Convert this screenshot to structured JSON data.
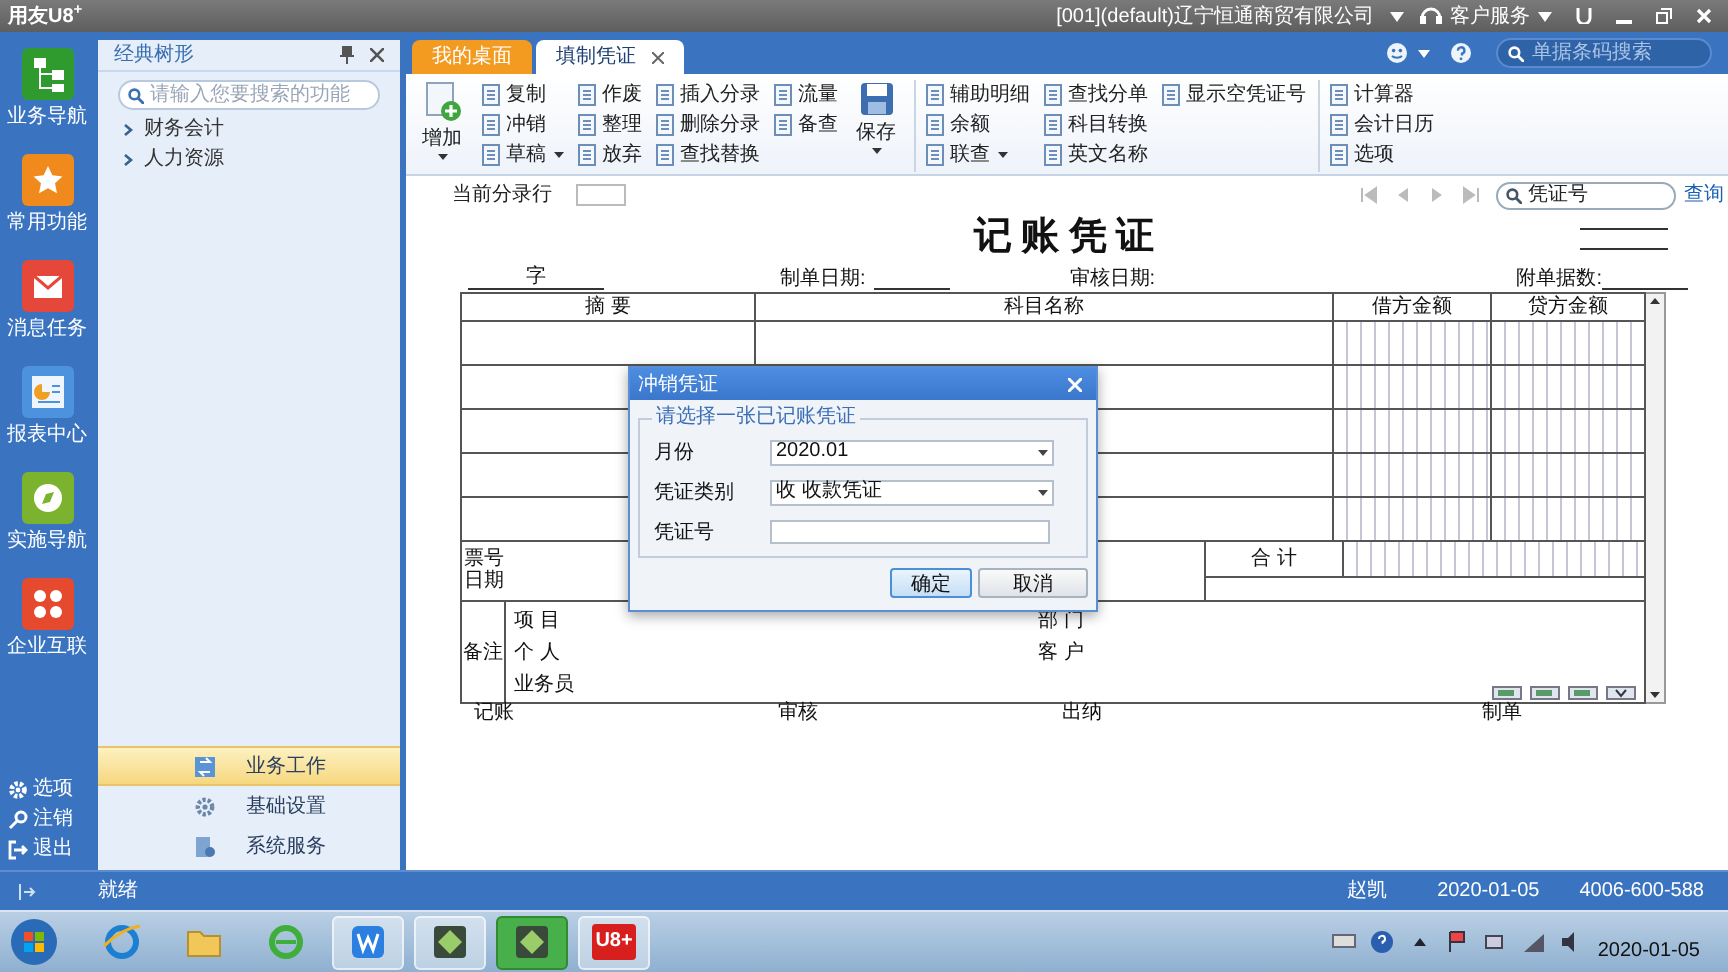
{
  "title_bar": {
    "app_name": "用友U8$^{+}$",
    "company": "[001](default)辽宁恒通商贸有限公司",
    "service": "客户服务"
  },
  "tabs": [
    {
      "label": "我的桌面",
      "selected": false,
      "closable": false
    },
    {
      "label": "填制凭证",
      "selected": true,
      "closable": true
    }
  ],
  "search": {
    "placeholder": "单据条码搜索"
  },
  "nav_rail": {
    "items": [
      {
        "label": "业务导航"
      },
      {
        "label": "常用功能"
      },
      {
        "label": "消息任务"
      },
      {
        "label": "报表中心"
      },
      {
        "label": "实施导航"
      },
      {
        "label": "企业互联"
      }
    ],
    "footer": [
      {
        "label": "选项"
      },
      {
        "label": "注销"
      },
      {
        "label": "退出"
      }
    ]
  },
  "tree_panel": {
    "title": "经典树形",
    "search_placeholder": "请输入您要搜索的功能",
    "items": [
      {
        "label": "财务会计",
        "expanded": false
      },
      {
        "label": "人力资源",
        "expanded": false
      }
    ],
    "sections": [
      {
        "label": "业务工作",
        "selected": true
      },
      {
        "label": "基础设置",
        "selected": false
      },
      {
        "label": "系统服务",
        "selected": false
      }
    ]
  },
  "toolbar": {
    "groups": [
      {
        "columns": [
          {
            "kind": "large",
            "items": [
              {
                "label": "增加",
                "dropdown": true
              }
            ]
          },
          {
            "kind": "small",
            "items": [
              {
                "label": "复制",
                "dropdown": false
              },
              {
                "label": "冲销",
                "dropdown": false
              },
              {
                "label": "草稿",
                "dropdown": true
              }
            ]
          },
          {
            "kind": "small",
            "items": [
              {
                "label": "作废",
                "dropdown": false
              },
              {
                "label": "整理",
                "dropdown": false
              },
              {
                "label": "放弃",
                "dropdown": false
              }
            ]
          },
          {
            "kind": "small",
            "items": [
              {
                "label": "插入分录",
                "dropdown": false
              },
              {
                "label": "删除分录",
                "dropdown": false
              },
              {
                "label": "查找替换",
                "dropdown": false
              }
            ]
          },
          {
            "kind": "small",
            "items": [
              {
                "label": "流量",
                "dropdown": false
              },
              {
                "label": "备查",
                "dropdown": false
              }
            ]
          },
          {
            "kind": "large",
            "items": [
              {
                "label": "保存",
                "dropdown": true
              }
            ]
          }
        ]
      },
      {
        "columns": [
          {
            "kind": "small",
            "items": [
              {
                "label": "辅助明细",
                "dropdown": false
              },
              {
                "label": "余额",
                "dropdown": false
              },
              {
                "label": "联查",
                "dropdown": true
              }
            ]
          },
          {
            "kind": "small",
            "items": [
              {
                "label": "查找分单",
                "dropdown": false
              },
              {
                "label": "科目转换",
                "dropdown": false
              },
              {
                "label": "英文名称",
                "dropdown": false
              }
            ]
          },
          {
            "kind": "small",
            "items": [
              {
                "label": "显示空凭证号",
                "dropdown": false
              }
            ]
          }
        ]
      },
      {
        "columns": [
          {
            "kind": "small",
            "items": [
              {
                "label": "计算器",
                "dropdown": false
              },
              {
                "label": "会计日历",
                "dropdown": false
              },
              {
                "label": "选项",
                "dropdown": false
              }
            ]
          }
        ]
      }
    ]
  },
  "voucher": {
    "current_row_label": "当前分录行",
    "search_label": "凭证号",
    "query_link": "查询",
    "title": "记 账 凭 证",
    "header_fields": [
      "字",
      "制单日期:",
      "审核日期:",
      "附单据数:"
    ],
    "columns": [
      "摘 要",
      "科目名称",
      "借方金额",
      "贷方金额"
    ],
    "ticket_labels": [
      "票号",
      "日期"
    ],
    "total_label": "合 计",
    "remarks_label": "备注",
    "remarks_left": [
      "项 目",
      "个 人",
      "业务员"
    ],
    "remarks_right": [
      "部 门",
      "客 户"
    ],
    "signatures": [
      "记账",
      "审核",
      "出纳",
      "制单"
    ]
  },
  "dialog": {
    "title": "冲销凭证",
    "group_label": "请选择一张已记账凭证",
    "fields": [
      {
        "label": "月份",
        "kind": "select",
        "value": "2020.01"
      },
      {
        "label": "凭证类别",
        "kind": "select",
        "value": "收 收款凭证"
      },
      {
        "label": "凭证号",
        "kind": "text"
      }
    ],
    "buttons": [
      {
        "label": "确定",
        "default": true
      },
      {
        "label": "取消",
        "default": false
      }
    ]
  },
  "status_bar": {
    "text": "就绪",
    "user": "赵凯",
    "date": "2020-01-05",
    "hotline": "4006-600-588"
  },
  "taskbar": {
    "apps": [
      {
        "kind": "ie",
        "selected": false
      },
      {
        "kind": "folder",
        "selected": false
      },
      {
        "kind": "browser360",
        "selected": false
      },
      {
        "kind": "wps",
        "selected": false
      },
      {
        "kind": "chip",
        "selected": false
      },
      {
        "kind": "chip",
        "selected": true
      },
      {
        "kind": "u8",
        "label": "U8+",
        "selected": false
      }
    ],
    "clock_date": "2020-01-05"
  }
}
